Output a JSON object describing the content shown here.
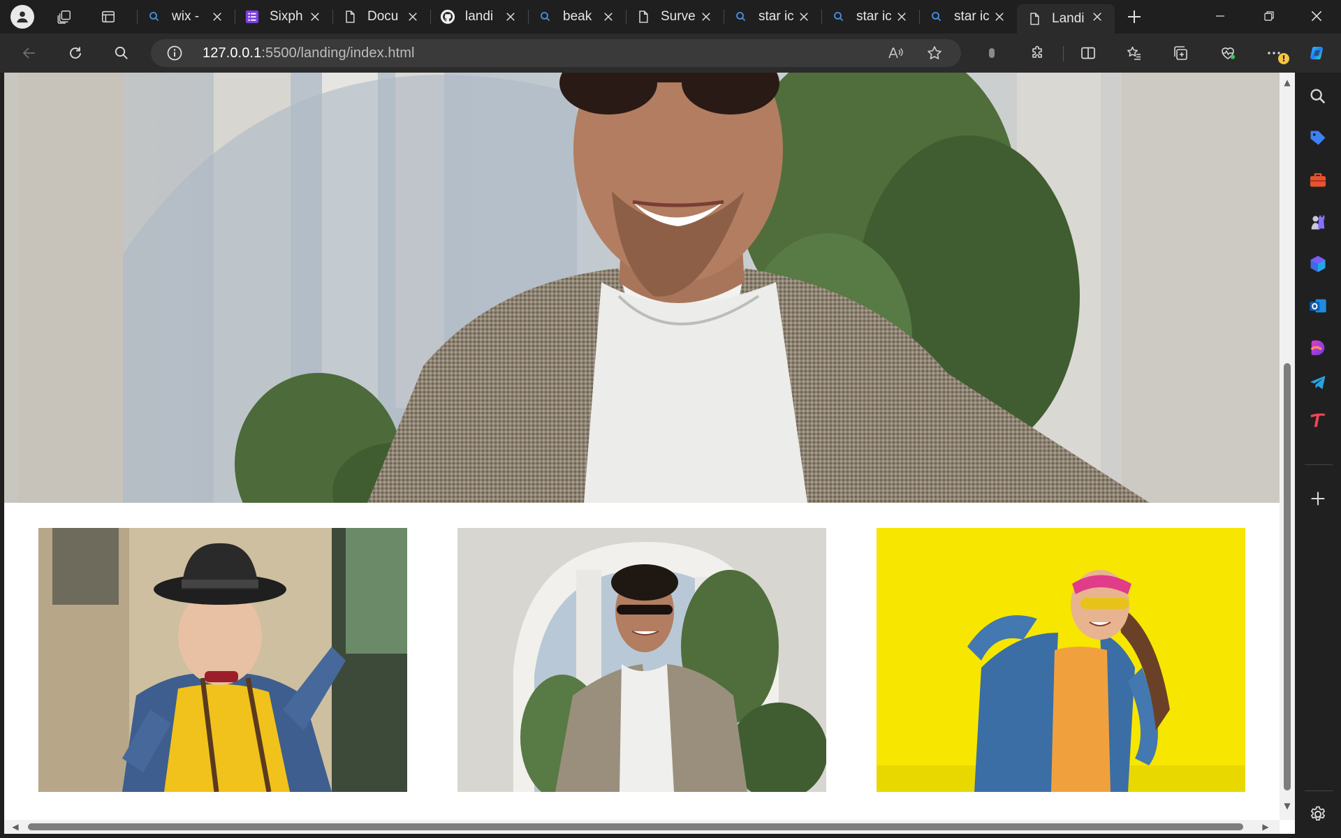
{
  "browser": {
    "tabs": [
      {
        "title": "wix -",
        "favicon": "search-icon"
      },
      {
        "title": "Sixph",
        "favicon": "forms-icon"
      },
      {
        "title": "Docu",
        "favicon": "document-icon"
      },
      {
        "title": "landi",
        "favicon": "github-icon"
      },
      {
        "title": "beak",
        "favicon": "search-icon"
      },
      {
        "title": "Surve",
        "favicon": "document-icon"
      },
      {
        "title": "star ic",
        "favicon": "search-icon"
      },
      {
        "title": "star ic",
        "favicon": "search-icon"
      },
      {
        "title": "star ic",
        "favicon": "search-icon"
      },
      {
        "title": "Landi",
        "favicon": "document-icon",
        "active": true
      }
    ],
    "address": {
      "host": "127.0.0.1",
      "rest": ":5500/landing/index.html"
    },
    "notification_badge": "!",
    "colors": {
      "chrome_dark": "#1f1f1f",
      "toolbar": "#2b2b2b",
      "omnibox": "#3a3a3a",
      "page_background": "#ffffff",
      "card3_background": "#f7e600"
    }
  },
  "page": {
    "hero_image": "man-in-blazer-and-sunglasses-photo",
    "gallery": [
      {
        "image": "boy-in-hat-and-yellow-sweater-photo"
      },
      {
        "image": "man-in-blazer-under-arch-photo"
      },
      {
        "image": "woman-in-denim-jacket-yellow-wall-photo"
      }
    ]
  }
}
